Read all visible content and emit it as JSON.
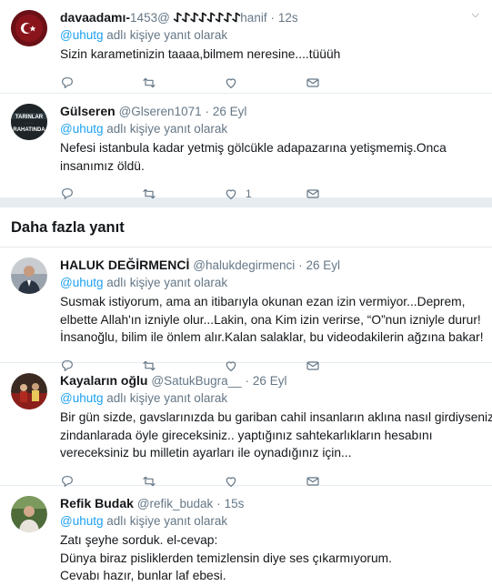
{
  "tweets_top": [
    {
      "name": "davaadamı-𐰀𐰀𐰀𐰀𐰀𐰀𐰀𐰀",
      "handle": "@1453hanif",
      "time": "12s",
      "reply_prefix": "",
      "mention": "@uhutg",
      "reply_suffix": "adlı kişiye yanıt olarak",
      "lines": [
        "Sizin karametinizin taaaa,bilmem neresine....tüüüh"
      ],
      "like_count": ""
    },
    {
      "name": "Gülseren",
      "handle": "@Glseren1071",
      "time": "26 Eyl",
      "mention": "@uhutg",
      "reply_suffix": "adlı kişiye yanıt olarak",
      "lines": [
        "Nefesi istanbula kadar yetmiş gölcükle adapazarına yetişmemiş.Onca",
        "insanımız öldü."
      ],
      "like_count": "1"
    }
  ],
  "more_replies_label": "Daha fazla yanıt",
  "tweets_more": [
    {
      "name": "HALUK DEĞİRMENCİ",
      "handle": "@halukdegirmenci",
      "time": "26 Eyl",
      "mention": "@uhutg",
      "reply_suffix": "adlı kişiye yanıt olarak",
      "lines": [
        "Susmak istiyorum, ama an itibarıyla okunan ezan izin vermiyor...Deprem,",
        "elbette Allah'ın izniyle olur...Lakin, ona Kim izin verirse, “O”nun izniyle durur!",
        "İnsanoğlu, bilim ile önlem alır.Kalan salaklar, bu videodakilerin ağzına bakar!"
      ],
      "like_count": ""
    },
    {
      "name": "Kayaların oğlu",
      "handle": "@SatukBugra__",
      "time": "26 Eyl",
      "mention": "@uhutg",
      "reply_suffix": "adlı kişiye yanıt olarak",
      "lines": [
        "Bir gün sizde, gavslarınızda bu gariban cahil insanların aklına nasıl girdiyseniz",
        "zindanlarada öyle gireceksiniz.. yaptığınız sahtekarlıkların hesabını",
        "vereceksiniz bu milletin ayarları ile oynadığınız için..."
      ],
      "like_count": ""
    },
    {
      "name": "Refik Budak",
      "handle": "@refik_budak",
      "time": "15s",
      "mention": "@uhutg",
      "reply_suffix": "adlı kişiye yanıt olarak",
      "lines": [
        "Zatı şeyhe sorduk. el-cevap:",
        "Dünya biraz pisliklerden temizlensin diye ses çıkarmıyorum.",
        "Cevabı hazır, bunlar laf ebesi."
      ],
      "like_count": ""
    }
  ],
  "icons": {
    "reply": "reply-icon",
    "retweet": "retweet-icon",
    "like": "heart-icon",
    "dm": "envelope-icon",
    "caret": "chevron-down-icon"
  },
  "colors": {
    "link": "#1da1f2",
    "muted": "#657786",
    "text": "#14171a",
    "separator": "#e6ecf0"
  }
}
